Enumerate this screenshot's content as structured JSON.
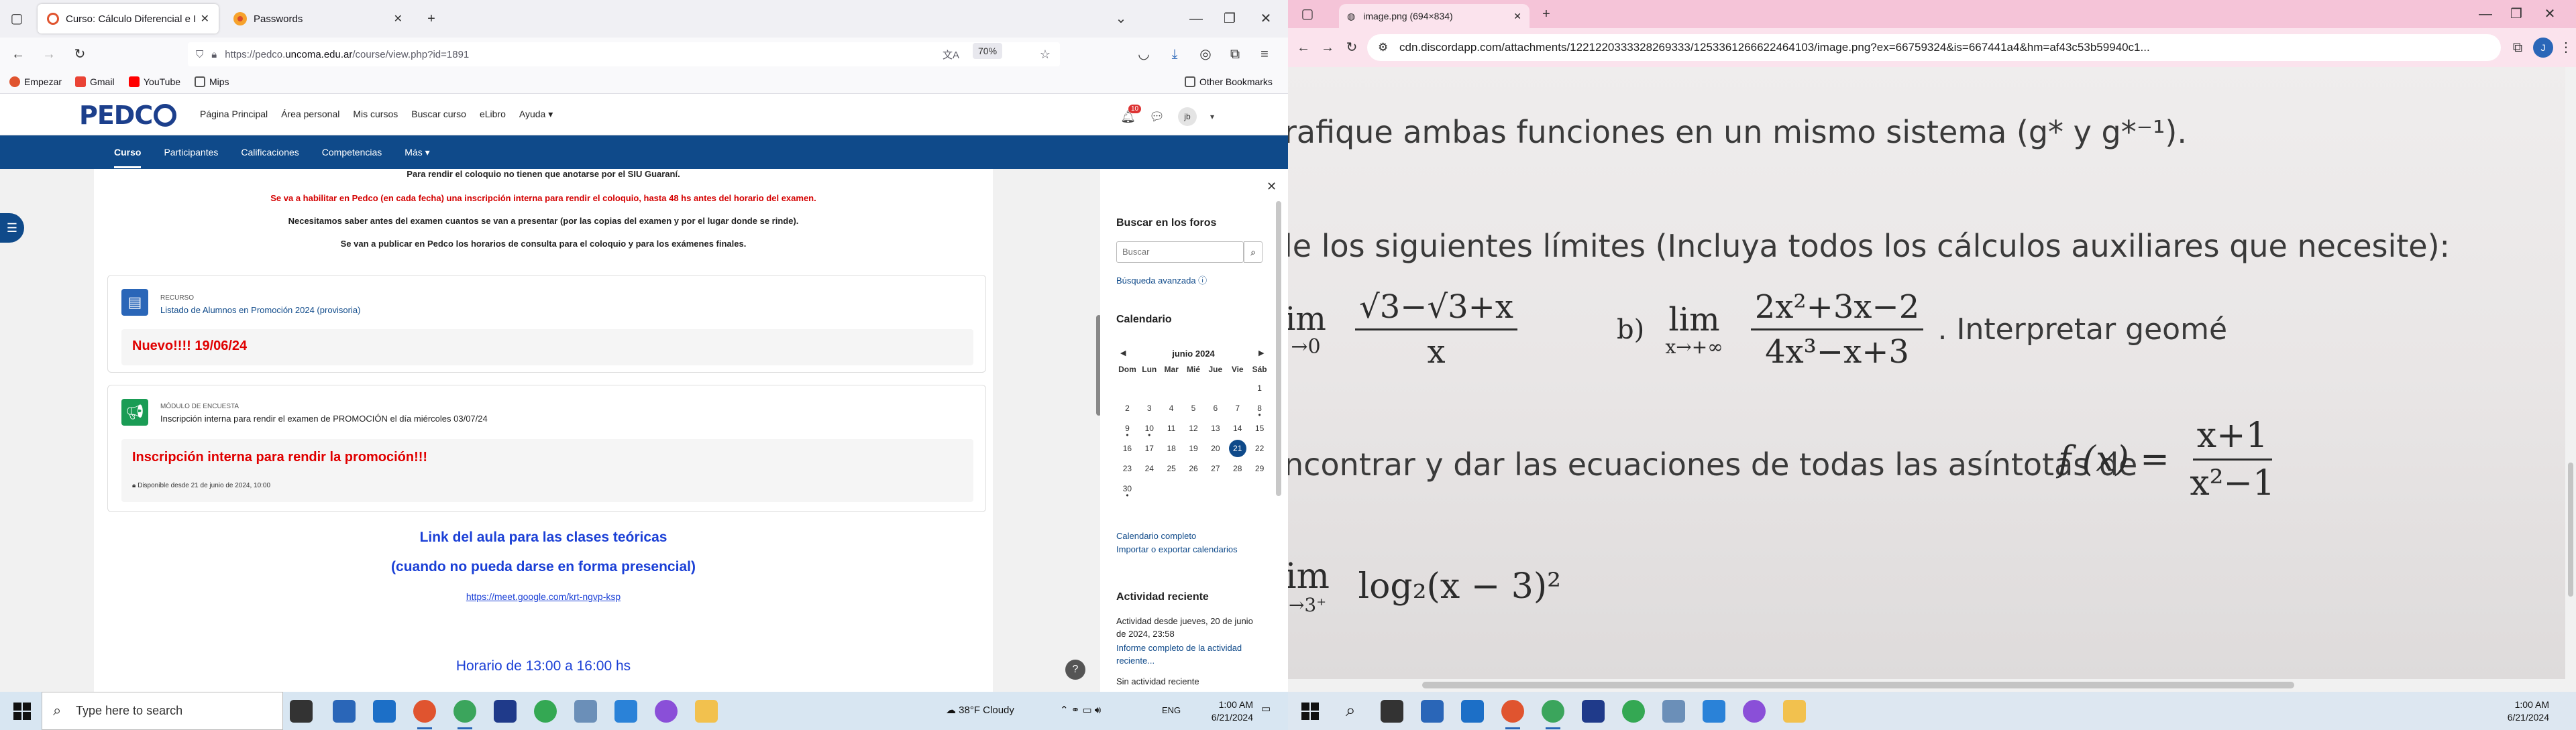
{
  "firefox": {
    "tabs": [
      {
        "label": "Curso: Cálculo Diferencial e Inte",
        "active": true
      },
      {
        "label": "Passwords",
        "active": false
      }
    ],
    "url": {
      "prefix": "https://pedco.",
      "host": "uncoma.edu.ar",
      "path": "/course/view.php?id=1891"
    },
    "zoom": "70%",
    "bookmarks": [
      "Empezar",
      "Gmail",
      "YouTube",
      "Mips"
    ],
    "other_bookmarks": "Other Bookmarks"
  },
  "pedco": {
    "logo": "PEDC",
    "top_nav": [
      "Página Principal",
      "Área personal",
      "Mis cursos",
      "Buscar curso",
      "eLibro",
      "Ayuda ▾"
    ],
    "notification_count": "10",
    "avatar": "jb",
    "course_nav": [
      "Curso",
      "Participantes",
      "Calificaciones",
      "Competencias",
      "Más ▾"
    ],
    "announcements": [
      {
        "text": "Para rendir el coloquio no tienen que anotarse por el SIU Guaraní.",
        "red": false
      },
      {
        "text": "Se va a habilitar en Pedco (en cada fecha) una inscripción interna para rendir el coloquio, hasta 48 hs antes del horario del examen.",
        "red": true
      },
      {
        "text": "Necesitamos saber antes del examen cuantos se van a presentar (por las copias del examen y por el lugar donde se rinde).",
        "red": false
      },
      {
        "text": "Se van a publicar en Pedco los horarios de consulta para el coloquio y para los exámenes finales.",
        "red": false
      }
    ],
    "resource": {
      "type": "RECURSO",
      "name": "Listado de Alumnos en Promoción 2024 (provisoria)",
      "alert": "Nuevo!!!! 19/06/24"
    },
    "survey": {
      "type": "MÓDULO DE ENCUESTA",
      "name": "Inscripción interna para rendir el examen de PROMOCIÓN el día miércoles 03/07/24",
      "alert": "Inscripción interna para rendir la promoción!!!",
      "availability": "Disponible desde 21 de junio de 2024, 10:00"
    },
    "link_heading": "Link del aula para las clases teóricas",
    "link_subheading": "(cuando no pueda darse en forma presencial)",
    "meet_link": "https://meet.google.com/krt-ngvp-ksp",
    "horario": "Horario de 13:00 a 16:00 hs",
    "help": "?"
  },
  "drawer": {
    "forum_title": "Buscar en los foros",
    "search_placeholder": "Buscar",
    "advanced_search": "Búsqueda avanzada",
    "calendar_title": "Calendario",
    "month": "junio 2024",
    "weekdays": [
      "Dom",
      "Lun",
      "Mar",
      "Mié",
      "Jue",
      "Vie",
      "Sáb"
    ],
    "days": [
      [
        "",
        "",
        "",
        "",
        "",
        "",
        "1"
      ],
      [
        "2",
        "3",
        "4",
        "5",
        "6",
        "7",
        "8"
      ],
      [
        "9",
        "10",
        "11",
        "12",
        "13",
        "14",
        "15"
      ],
      [
        "16",
        "17",
        "18",
        "19",
        "20",
        "21",
        "22"
      ],
      [
        "23",
        "24",
        "25",
        "26",
        "27",
        "28",
        "29"
      ],
      [
        "30",
        "",
        "",
        "",
        "",
        "",
        ""
      ]
    ],
    "today": "21",
    "event_days": [
      "8",
      "9",
      "10",
      "30"
    ],
    "calendar_full": "Calendario completo",
    "calendar_export": "Importar o exportar calendarios",
    "recent_title": "Actividad reciente",
    "recent_since": "Actividad desde jueves, 20 de junio de 2024, 23:58",
    "recent_report": "Informe completo de la actividad reciente...",
    "recent_none": "Sin actividad reciente"
  },
  "chrome": {
    "tab_title": "image.png (694×834)",
    "url": "cdn.discordapp.com/attachments/1221220333328269333/1253361266622464103/image.png?ex=66759324&is=667441a4&hm=af43c53b59940c1..."
  },
  "worksheet": {
    "line1": "rafique ambas funciones en un mismo sistema (g* y g*⁻¹).",
    "line2": "le los siguientes límites (Incluya todos los cálculos auxiliares que necesite):",
    "limit_a_prefix": "im",
    "limit_a_sub": "→0",
    "limit_a_num": "√3−√3+x",
    "limit_a_den": "x",
    "limit_b_label": "b)",
    "limit_b_lim": "lim",
    "limit_b_sub": "x→+∞",
    "limit_b_num": "2x²+3x−2",
    "limit_b_den": "4x³−x+3",
    "limit_b_tail": ". Interpretar geomé",
    "line4_text": "ncontrar y dar las ecuaciones de todas las asíntotas de",
    "line4_fx": "f (x) =",
    "line4_num": "x+1",
    "line4_den": "x²−1",
    "line5_lim": "im",
    "line5_sub": "→3⁺",
    "line5_expr": "log₂(x − 3)²"
  },
  "taskbar_left": {
    "search_placeholder": "Type here to search",
    "weather": "38°F  Cloudy",
    "lang": "ENG",
    "time": "1:00 AM",
    "date": "6/21/2024"
  },
  "taskbar_right": {
    "time": "1:00 AM",
    "date": "6/21/2024"
  },
  "colors": {
    "pedco_blue": "#0f4a8a",
    "alert_red": "#e00000",
    "link_blue": "#1a3fd6",
    "chrome_pink": "#f5c4d8"
  }
}
